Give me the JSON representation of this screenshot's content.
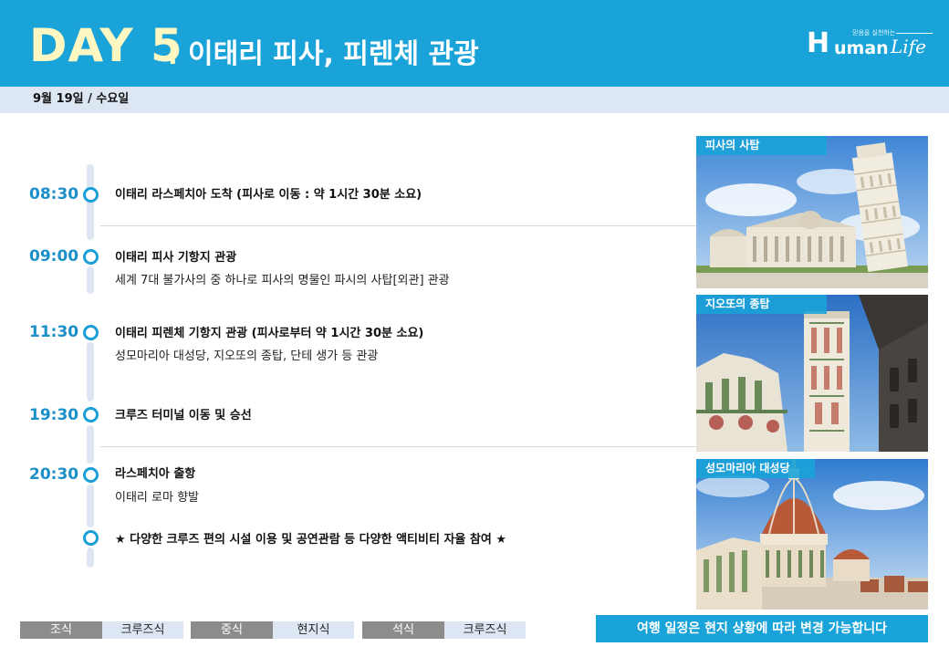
{
  "header": {
    "day": "DAY  5",
    "dot": ".",
    "title": "이태리 피사, 피렌체 관광",
    "logo_h": "H",
    "logo_uman": "uman",
    "logo_life": "Life",
    "logo_tagline": "믿음을 실천하는",
    "bg_color": "#19a3d8"
  },
  "date": "9월 19일 / 수요일",
  "schedule": [
    {
      "time": "08:30",
      "title": "이태리 라스페치아 도착 (피사로 이동 : 약 1시간 30분 소요)",
      "desc": ""
    },
    {
      "time": "09:00",
      "title": "이태리 피사 기항지 관광",
      "desc": "세계 7대 불가사의 중 하나로 피사의 명물인 파시의 사탑[외관] 관광"
    },
    {
      "time": "11:30",
      "title": "이태리 피렌체 기항지 관광 (피사로부터 약 1시간 30분 소요)",
      "desc": "성모마리아 대성당, 지오또의 종탑, 단테 생가 등 관광"
    },
    {
      "time": "19:30",
      "title": "크루즈 터미널 이동 및 승선",
      "desc": ""
    },
    {
      "time": "20:30",
      "title": "라스페치아 출항",
      "desc": "이태리 로마 향발"
    },
    {
      "time": "",
      "title": "★ 다양한 크루즈 편의 시설 이용 및 공연관람 등 다양한 액티비티 자율 참여 ★",
      "desc": ""
    }
  ],
  "photos": [
    {
      "label": "피사의 사탑"
    },
    {
      "label": "지오또의 종탑"
    },
    {
      "label": "성모마리아 대성당"
    }
  ],
  "meals": [
    {
      "type": "조식",
      "value": "크루즈식"
    },
    {
      "type": "중식",
      "value": "현지식"
    },
    {
      "type": "석식",
      "value": "크루즈식"
    }
  ],
  "notice": "여행 일정은 현지 상황에 따라 변경 가능합니다"
}
